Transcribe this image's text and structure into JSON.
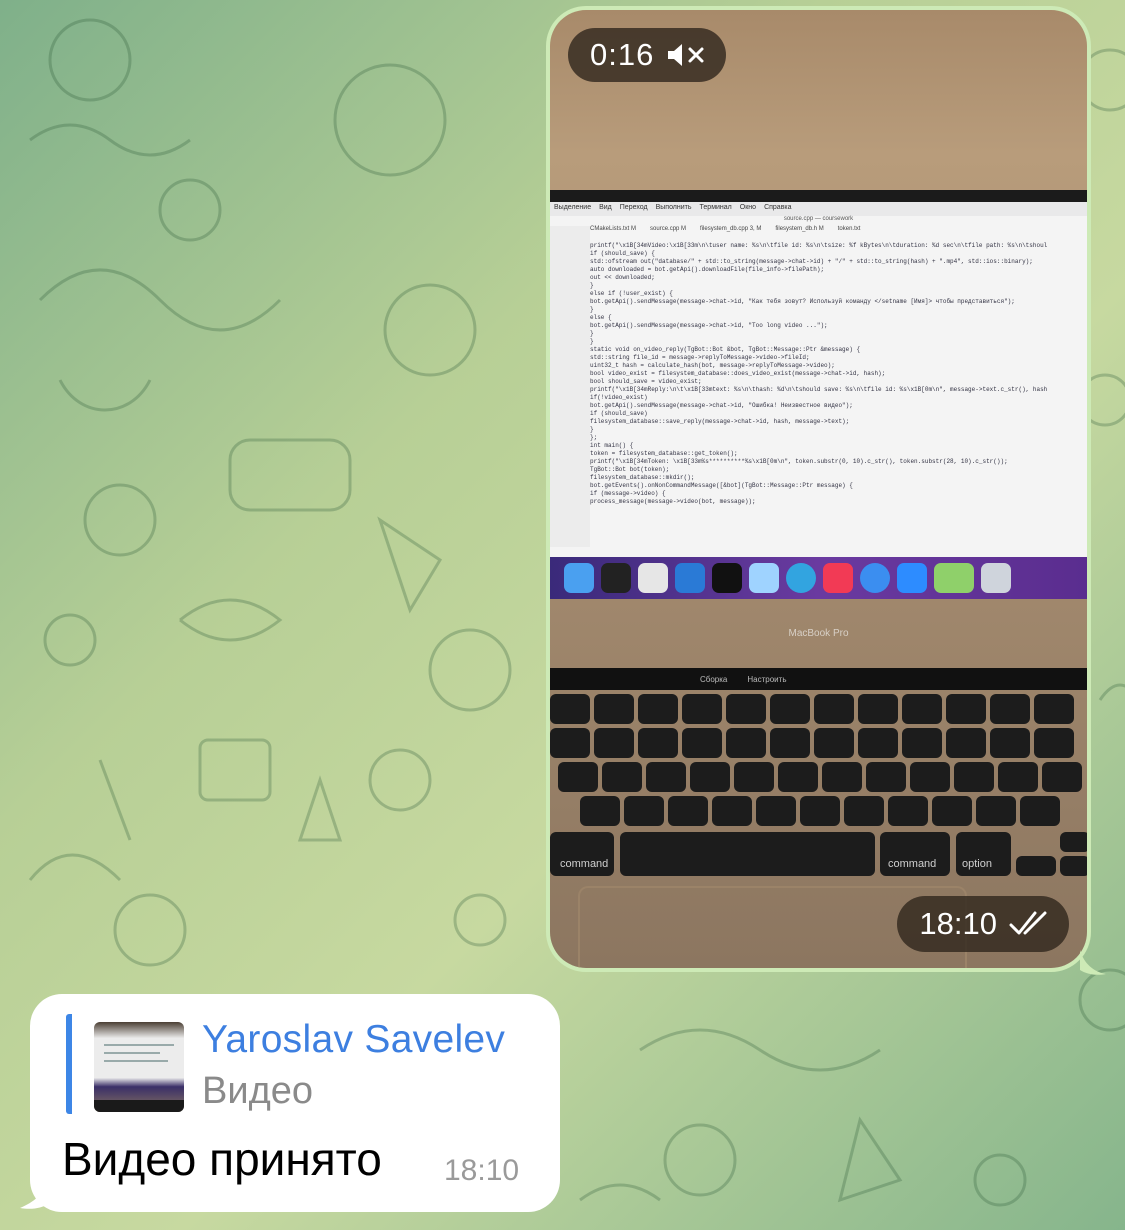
{
  "video_message": {
    "duration": "0:16",
    "mute_icon": "speaker-muted-icon",
    "time": "18:10",
    "read_status_icon": "double-check-icon",
    "screen": {
      "menu_items": [
        "Выделение",
        "Вид",
        "Переход",
        "Выполнить",
        "Терминал",
        "Окно",
        "Справка"
      ],
      "window_title": "source.cpp — coursework",
      "tabs": [
        "CMakeLists.txt M",
        "source.cpp M",
        "filesystem_db.cpp 3, M",
        "filesystem_db.h M",
        "token.txt"
      ],
      "code_lines": [
        "printf(\"\\x1B[34mVideo:\\x1B[33m\\n\\tuser name: %s\\n\\tfile id: %s\\n\\tsize: %f kBytes\\n\\tduration: %d sec\\n\\tfile path: %s\\n\\tshoul",
        "if (should_save) {",
        "std::ofstream out(\"database/\" + std::to_string(message->chat->id) + \"/\" + std::to_string(hash) + \".mp4\", std::ios::binary);",
        "auto downloaded = bot.getApi().downloadFile(file_info->filePath);",
        "out << downloaded;",
        "}",
        "else if (!user_exist) {",
        "bot.getApi().sendMessage(message->chat->id, \"Как тебя зовут? Используй команду </setname [Имя]> чтобы представиться\");",
        "}",
        "else {",
        "bot.getApi().sendMessage(message->chat->id, \"Too long video ...\");",
        "}",
        "}",
        "",
        "static void on_video_reply(TgBot::Bot &bot, TgBot::Message::Ptr &message) {",
        "std::string file_id = message->replyToMessage->video->fileId;",
        "uint32_t hash = calculate_hash(bot, message->replyToMessage->video);",
        "bool video_exist = filesystem_database::does_video_exist(message->chat->id, hash);",
        "bool should_save = video_exist;",
        "printf(\"\\x1B[34mReply:\\n\\t\\x1B[33mtext: %s\\n\\thash: %d\\n\\tshould save: %s\\n\\tfile id: %s\\x1B[0m\\n\", message->text.c_str(), hash",
        "if(!video_exist)",
        "bot.getApi().sendMessage(message->chat->id, \"Ошибка! Неизвестное видео\");",
        "if (should_save)",
        "filesystem_database::save_reply(message->chat->id, hash, message->text);",
        "}",
        "};",
        "",
        "int main() {",
        "token = filesystem_database::get_token();",
        "printf(\"\\x1B[34mToken: \\x1B[33m%s**********%s\\x1B[0m\\n\", token.substr(0, 10).c_str(), token.substr(28, 10).c_str());",
        "TgBot::Bot bot(token);",
        "filesystem_database::mkdir();",
        "bot.getEvents().onNonCommandMessage([&bot](TgBot::Message::Ptr message) {",
        "if (message->video) {",
        "process_message(message->video(bot, message));"
      ],
      "laptop_label": "MacBook Pro",
      "touchbar": [
        "Сборка",
        "Настроить"
      ],
      "keys": {
        "command_left": "command",
        "command_right": "command",
        "option": "option"
      }
    }
  },
  "reply_message": {
    "quoted_author": "Yaroslav Savelev",
    "quoted_type": "Видео",
    "text": "Видео принято",
    "time": "18:10"
  },
  "colors": {
    "outgoing_bubble": "#cdeab6",
    "incoming_bubble": "#ffffff",
    "accent_blue": "#3d7fe0",
    "pill_bg": "#322820"
  }
}
